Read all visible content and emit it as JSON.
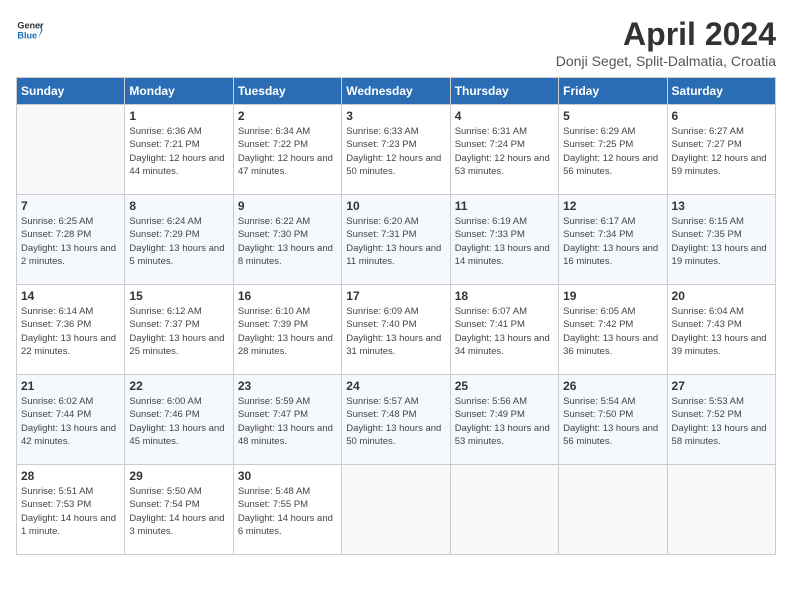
{
  "header": {
    "logo_line1": "General",
    "logo_line2": "Blue",
    "month_title": "April 2024",
    "location": "Donji Seget, Split-Dalmatia, Croatia"
  },
  "columns": [
    "Sunday",
    "Monday",
    "Tuesday",
    "Wednesday",
    "Thursday",
    "Friday",
    "Saturday"
  ],
  "weeks": [
    [
      {
        "day": "",
        "sunrise": "",
        "sunset": "",
        "daylight": ""
      },
      {
        "day": "1",
        "sunrise": "Sunrise: 6:36 AM",
        "sunset": "Sunset: 7:21 PM",
        "daylight": "Daylight: 12 hours and 44 minutes."
      },
      {
        "day": "2",
        "sunrise": "Sunrise: 6:34 AM",
        "sunset": "Sunset: 7:22 PM",
        "daylight": "Daylight: 12 hours and 47 minutes."
      },
      {
        "day": "3",
        "sunrise": "Sunrise: 6:33 AM",
        "sunset": "Sunset: 7:23 PM",
        "daylight": "Daylight: 12 hours and 50 minutes."
      },
      {
        "day": "4",
        "sunrise": "Sunrise: 6:31 AM",
        "sunset": "Sunset: 7:24 PM",
        "daylight": "Daylight: 12 hours and 53 minutes."
      },
      {
        "day": "5",
        "sunrise": "Sunrise: 6:29 AM",
        "sunset": "Sunset: 7:25 PM",
        "daylight": "Daylight: 12 hours and 56 minutes."
      },
      {
        "day": "6",
        "sunrise": "Sunrise: 6:27 AM",
        "sunset": "Sunset: 7:27 PM",
        "daylight": "Daylight: 12 hours and 59 minutes."
      }
    ],
    [
      {
        "day": "7",
        "sunrise": "Sunrise: 6:25 AM",
        "sunset": "Sunset: 7:28 PM",
        "daylight": "Daylight: 13 hours and 2 minutes."
      },
      {
        "day": "8",
        "sunrise": "Sunrise: 6:24 AM",
        "sunset": "Sunset: 7:29 PM",
        "daylight": "Daylight: 13 hours and 5 minutes."
      },
      {
        "day": "9",
        "sunrise": "Sunrise: 6:22 AM",
        "sunset": "Sunset: 7:30 PM",
        "daylight": "Daylight: 13 hours and 8 minutes."
      },
      {
        "day": "10",
        "sunrise": "Sunrise: 6:20 AM",
        "sunset": "Sunset: 7:31 PM",
        "daylight": "Daylight: 13 hours and 11 minutes."
      },
      {
        "day": "11",
        "sunrise": "Sunrise: 6:19 AM",
        "sunset": "Sunset: 7:33 PM",
        "daylight": "Daylight: 13 hours and 14 minutes."
      },
      {
        "day": "12",
        "sunrise": "Sunrise: 6:17 AM",
        "sunset": "Sunset: 7:34 PM",
        "daylight": "Daylight: 13 hours and 16 minutes."
      },
      {
        "day": "13",
        "sunrise": "Sunrise: 6:15 AM",
        "sunset": "Sunset: 7:35 PM",
        "daylight": "Daylight: 13 hours and 19 minutes."
      }
    ],
    [
      {
        "day": "14",
        "sunrise": "Sunrise: 6:14 AM",
        "sunset": "Sunset: 7:36 PM",
        "daylight": "Daylight: 13 hours and 22 minutes."
      },
      {
        "day": "15",
        "sunrise": "Sunrise: 6:12 AM",
        "sunset": "Sunset: 7:37 PM",
        "daylight": "Daylight: 13 hours and 25 minutes."
      },
      {
        "day": "16",
        "sunrise": "Sunrise: 6:10 AM",
        "sunset": "Sunset: 7:39 PM",
        "daylight": "Daylight: 13 hours and 28 minutes."
      },
      {
        "day": "17",
        "sunrise": "Sunrise: 6:09 AM",
        "sunset": "Sunset: 7:40 PM",
        "daylight": "Daylight: 13 hours and 31 minutes."
      },
      {
        "day": "18",
        "sunrise": "Sunrise: 6:07 AM",
        "sunset": "Sunset: 7:41 PM",
        "daylight": "Daylight: 13 hours and 34 minutes."
      },
      {
        "day": "19",
        "sunrise": "Sunrise: 6:05 AM",
        "sunset": "Sunset: 7:42 PM",
        "daylight": "Daylight: 13 hours and 36 minutes."
      },
      {
        "day": "20",
        "sunrise": "Sunrise: 6:04 AM",
        "sunset": "Sunset: 7:43 PM",
        "daylight": "Daylight: 13 hours and 39 minutes."
      }
    ],
    [
      {
        "day": "21",
        "sunrise": "Sunrise: 6:02 AM",
        "sunset": "Sunset: 7:44 PM",
        "daylight": "Daylight: 13 hours and 42 minutes."
      },
      {
        "day": "22",
        "sunrise": "Sunrise: 6:00 AM",
        "sunset": "Sunset: 7:46 PM",
        "daylight": "Daylight: 13 hours and 45 minutes."
      },
      {
        "day": "23",
        "sunrise": "Sunrise: 5:59 AM",
        "sunset": "Sunset: 7:47 PM",
        "daylight": "Daylight: 13 hours and 48 minutes."
      },
      {
        "day": "24",
        "sunrise": "Sunrise: 5:57 AM",
        "sunset": "Sunset: 7:48 PM",
        "daylight": "Daylight: 13 hours and 50 minutes."
      },
      {
        "day": "25",
        "sunrise": "Sunrise: 5:56 AM",
        "sunset": "Sunset: 7:49 PM",
        "daylight": "Daylight: 13 hours and 53 minutes."
      },
      {
        "day": "26",
        "sunrise": "Sunrise: 5:54 AM",
        "sunset": "Sunset: 7:50 PM",
        "daylight": "Daylight: 13 hours and 56 minutes."
      },
      {
        "day": "27",
        "sunrise": "Sunrise: 5:53 AM",
        "sunset": "Sunset: 7:52 PM",
        "daylight": "Daylight: 13 hours and 58 minutes."
      }
    ],
    [
      {
        "day": "28",
        "sunrise": "Sunrise: 5:51 AM",
        "sunset": "Sunset: 7:53 PM",
        "daylight": "Daylight: 14 hours and 1 minute."
      },
      {
        "day": "29",
        "sunrise": "Sunrise: 5:50 AM",
        "sunset": "Sunset: 7:54 PM",
        "daylight": "Daylight: 14 hours and 3 minutes."
      },
      {
        "day": "30",
        "sunrise": "Sunrise: 5:48 AM",
        "sunset": "Sunset: 7:55 PM",
        "daylight": "Daylight: 14 hours and 6 minutes."
      },
      {
        "day": "",
        "sunrise": "",
        "sunset": "",
        "daylight": ""
      },
      {
        "day": "",
        "sunrise": "",
        "sunset": "",
        "daylight": ""
      },
      {
        "day": "",
        "sunrise": "",
        "sunset": "",
        "daylight": ""
      },
      {
        "day": "",
        "sunrise": "",
        "sunset": "",
        "daylight": ""
      }
    ]
  ]
}
